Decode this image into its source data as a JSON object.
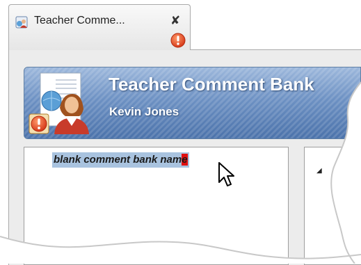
{
  "tab": {
    "title": "Teacher Comme...",
    "close_glyph": "✘",
    "icons": {
      "app": "teacher-comment-bank-app-icon",
      "close": "close-icon",
      "alert": "error-alert-icon"
    }
  },
  "header": {
    "title": "Teacher Comment Bank",
    "teacher_name": "Kevin Jones",
    "avatar_icon": "teacher-avatar-icon",
    "alert_icon": "error-alert-icon"
  },
  "comment_bank": {
    "name_text": "blank comment bank nam",
    "name_flagged_char": "e",
    "error_color": "#e01010",
    "selection_color": "#a9c3df"
  },
  "tree": {
    "expand_glyph": "◢"
  },
  "colors": {
    "header_top": "#9db8dc",
    "header_bottom": "#4c73ab",
    "alert_red": "#e04c2a"
  }
}
